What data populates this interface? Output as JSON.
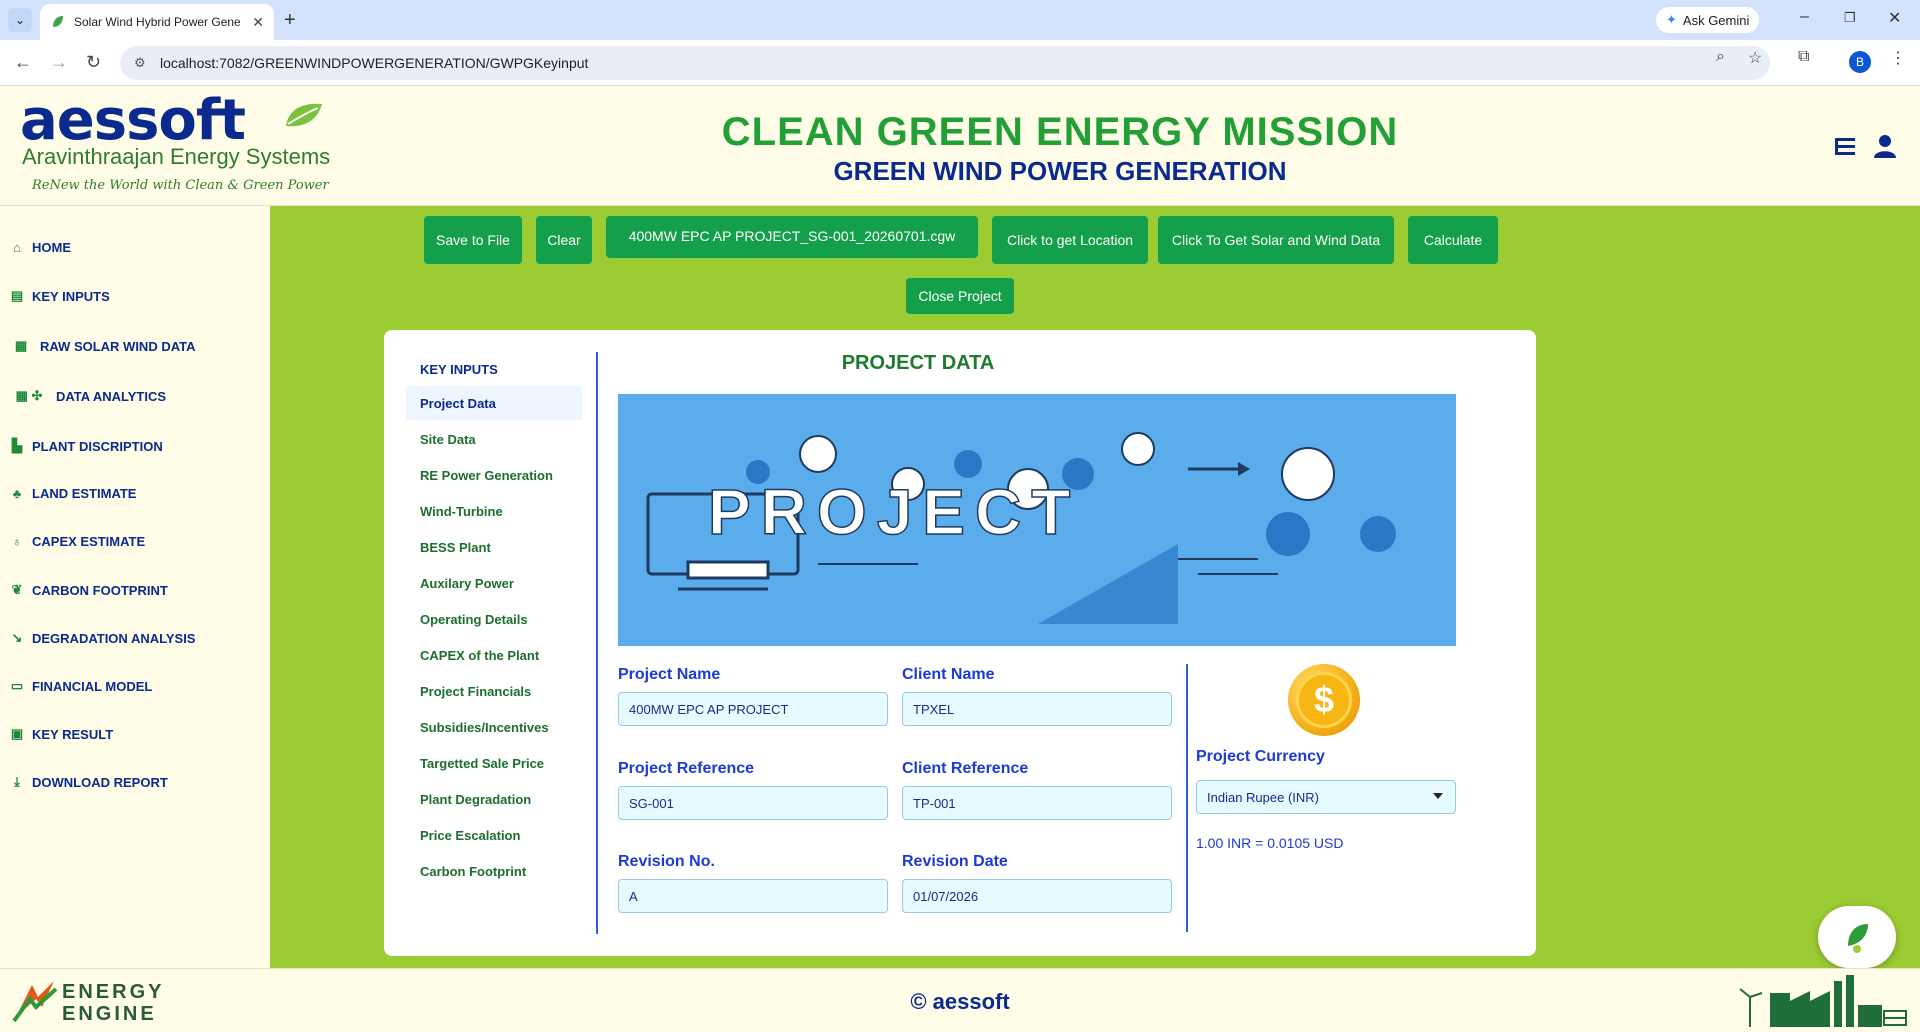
{
  "browser": {
    "tab_title": "Solar Wind Hybrid Power Gene",
    "ask_gemini": "Ask Gemini",
    "url": "localhost:7082/GREENWINDPOWERGENERATION/GWPGKeyinput",
    "profile_initial": "B"
  },
  "header": {
    "logo_main": "aessoft",
    "logo_sub": "Aravinthraajan Energy Systems",
    "logo_tagline": "ReNew the World with Clean & Green Power",
    "title": "CLEAN GREEN ENERGY MISSION",
    "subtitle": "GREEN WIND POWER GENERATION"
  },
  "sidebar": {
    "items": [
      {
        "label": "HOME",
        "icon": "home-icon"
      },
      {
        "label": "KEY INPUTS",
        "icon": "keyboard-icon"
      },
      {
        "label": "RAW SOLAR WIND DATA",
        "icon": "solar-panel-icon"
      },
      {
        "label": "DATA ANALYTICS",
        "icon": "analytics-icon"
      },
      {
        "label": "PLANT DISCRIPTION",
        "icon": "industry-icon"
      },
      {
        "label": "LAND ESTIMATE",
        "icon": "land-icon"
      },
      {
        "label": "CAPEX ESTIMATE",
        "icon": "money-bag-icon"
      },
      {
        "label": "CARBON FOOTPRINT",
        "icon": "leaf-icon"
      },
      {
        "label": "DEGRADATION ANALYSIS",
        "icon": "trend-down-icon"
      },
      {
        "label": "FINANCIAL MODEL",
        "icon": "money-icon"
      },
      {
        "label": "KEY RESULT",
        "icon": "result-icon"
      },
      {
        "label": "DOWNLOAD REPORT",
        "icon": "download-icon"
      }
    ]
  },
  "actions": {
    "save": "Save to File",
    "clear": "Clear",
    "file_name": "400MW EPC AP PROJECT_SG-001_20260701.cgw",
    "location": "Click to get Location",
    "solar_wind": "Click To Get Solar and Wind Data",
    "calculate": "Calculate",
    "close": "Close Project"
  },
  "key_inputs": {
    "title": "KEY INPUTS",
    "items": [
      "Project Data",
      "Site Data",
      "RE Power Generation",
      "Wind-Turbine",
      "BESS Plant",
      "Auxilary Power",
      "Operating Details",
      "CAPEX of the Plant",
      "Project Financials",
      "Subsidies/Incentives",
      "Targetted Sale Price",
      "Plant Degradation",
      "Price Escalation",
      "Carbon Footprint"
    ],
    "active_index": 0
  },
  "project_data": {
    "title": "PROJECT DATA",
    "banner_text": "PROJECT",
    "project_name_label": "Project Name",
    "project_name": "400MW EPC AP PROJECT",
    "client_name_label": "Client Name",
    "client_name": "TPXEL",
    "project_ref_label": "Project Reference",
    "project_ref": "SG-001",
    "client_ref_label": "Client Reference",
    "client_ref": "TP-001",
    "revision_no_label": "Revision No.",
    "revision_no": "A",
    "revision_date_label": "Revision Date",
    "revision_date": "01/07/2026",
    "currency_label": "Project Currency",
    "currency": "Indian Rupee (INR)",
    "rate": "1.00 INR = 0.0105 USD",
    "coin_symbol": "$"
  },
  "footer": {
    "brand_line1": "ENERGY",
    "brand_line2": "ENGINE",
    "copyright": "© aessoft"
  },
  "colors": {
    "brand_blue": "#0a2a8e",
    "brand_green": "#22a036",
    "main_bg": "#9ccc33",
    "button_green": "#14a04a",
    "page_bg": "#fffde8"
  }
}
